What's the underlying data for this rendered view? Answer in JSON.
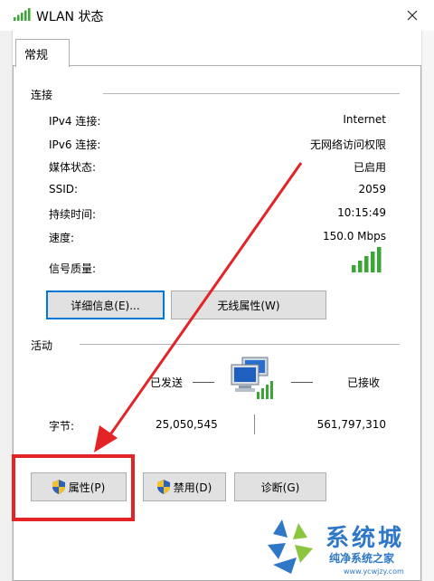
{
  "window": {
    "title": "WLAN 状态",
    "close_icon": "close-icon"
  },
  "tabs": [
    {
      "label": "常规"
    }
  ],
  "connection": {
    "section_label": "连接",
    "rows": [
      {
        "label": "IPv4 连接:",
        "value": "Internet"
      },
      {
        "label": "IPv6 连接:",
        "value": "无网络访问权限"
      },
      {
        "label": "媒体状态:",
        "value": "已启用"
      },
      {
        "label": "SSID:",
        "value": "2059"
      },
      {
        "label": "持续时间:",
        "value": "10:15:49"
      },
      {
        "label": "速度:",
        "value": "150.0 Mbps"
      },
      {
        "label": "信号质量:",
        "value": ""
      }
    ],
    "signal_bars": 5,
    "signal_bars_total": 5,
    "details_button": "详细信息(E)...",
    "wireless_props_button": "无线属性(W)"
  },
  "activity": {
    "section_label": "活动",
    "sent_label": "已发送",
    "received_label": "已接收",
    "bytes_label": "字节:",
    "bytes_sent": "25,050,545",
    "bytes_received": "561,797,310"
  },
  "buttons": {
    "properties": "属性(P)",
    "disable": "禁用(D)",
    "diagnose": "诊断(G)"
  },
  "watermark": {
    "main": "系统城",
    "sub": "纯净系统之家",
    "url": "www.ycwjzy.com"
  },
  "colors": {
    "annotation_red": "#e32326",
    "focus_blue": "#0078d7",
    "signal_green": "#3aa635",
    "watermark_blue": "#2f78c8"
  }
}
